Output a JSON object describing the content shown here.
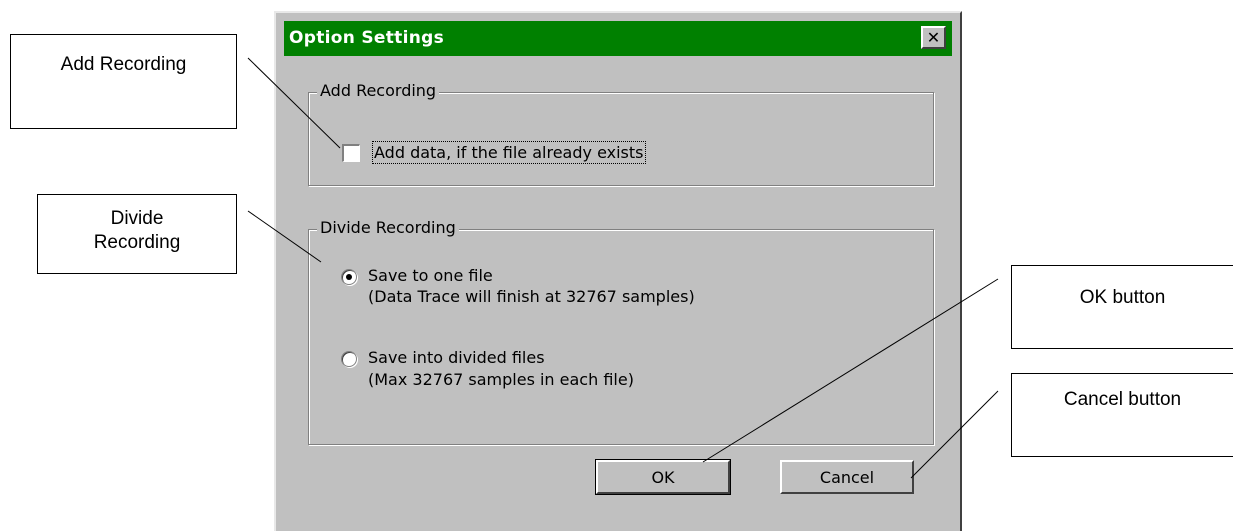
{
  "dialog": {
    "title": "Option Settings",
    "close_glyph": "✕",
    "title_bar_color": "#008000",
    "face_color": "#c0c0c0"
  },
  "add_recording": {
    "group_label": "Add Recording",
    "checkbox_label": "Add data, if the file already exists",
    "checked": false
  },
  "divide_recording": {
    "group_label": "Divide Recording",
    "options": [
      {
        "line1": "Save to one file",
        "line2": "(Data Trace will finish at 32767 samples)",
        "selected": true
      },
      {
        "line1": "Save into divided files",
        "line2": "(Max 32767 samples in each file)",
        "selected": false
      }
    ]
  },
  "buttons": {
    "ok_label": "OK",
    "cancel_label": "Cancel"
  },
  "callouts": {
    "add_recording": "Add Recording",
    "divide_recording_line1": "Divide",
    "divide_recording_line2": "Recording",
    "ok_button": "OK button",
    "cancel_button": "Cancel button"
  }
}
